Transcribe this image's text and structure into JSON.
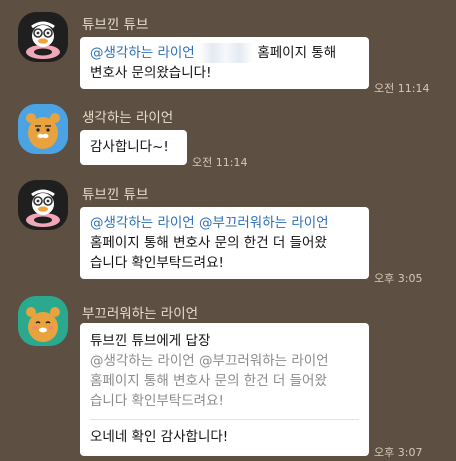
{
  "colors": {
    "background": "#5d4f42",
    "bubble": "#ffffff",
    "mention": "#2c6fb7",
    "quote_text": "#8b8b8b"
  },
  "messages": [
    {
      "sender": "튜브낀 튜브",
      "avatar_icon": "tube-duck-avatar",
      "mention": "@생각하는 라이언",
      "line1_rest": "홈페이지 통해",
      "line2": "변호사 문의왔습니다!",
      "time": "오전 11:14"
    },
    {
      "sender": "생각하는 라이언",
      "avatar_icon": "ryan-lion-avatar",
      "text": "감사합니다~!",
      "time": "오전 11:14"
    },
    {
      "sender": "튜브낀 튜브",
      "avatar_icon": "tube-duck-avatar",
      "mention1": "@생각하는 라이언",
      "mention2": "@부끄러워하는 라이언",
      "line2": "홈페이지 통해 변호사 문의 한건 더 들어왔",
      "line3": "습니다 확인부탁드려요!",
      "time": "오후 3:05"
    },
    {
      "sender": "부끄러워하는 라이언",
      "avatar_icon": "shy-ryan-avatar",
      "reply_header": "튜브낀 튜브에게 답장",
      "quote_lines": [
        "@생각하는 라이언 @부끄러워하는 라이언",
        "홈페이지 통해 변호사 문의 한건 더 들어왔",
        "습니다 확인부탁드려요!"
      ],
      "text": "오네네 확인 감사합니다!",
      "time": "오후 3:07"
    }
  ]
}
